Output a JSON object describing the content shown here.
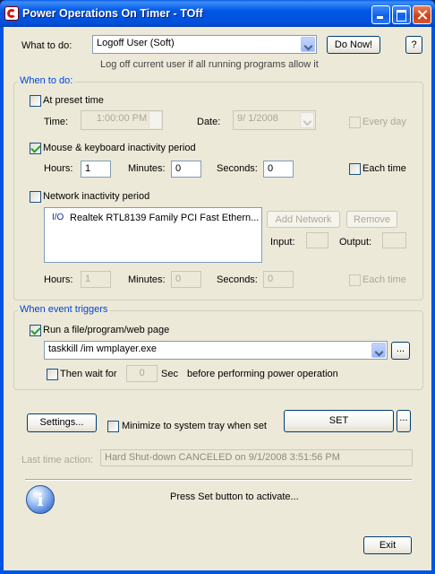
{
  "window": {
    "title": "Power Operations On Timer - TOff"
  },
  "what_to_do": {
    "label": "What to do:",
    "selected": "Logoff User (Soft)",
    "do_now_label": "Do Now!",
    "help_label": "?",
    "description": "Log off current user if all running programs allow it"
  },
  "when_to_do": {
    "title": "When to do:",
    "preset": {
      "label": "At preset time",
      "checked": false,
      "time_label": "Time:",
      "time_value": "1:00:00 PM",
      "date_label": "Date:",
      "date_value": "9/  1/2008",
      "every_day_label": "Every day"
    },
    "inactivity": {
      "label": "Mouse & keyboard inactivity period",
      "checked": true,
      "hours_label": "Hours:",
      "hours": "1",
      "minutes_label": "Minutes:",
      "minutes": "0",
      "seconds_label": "Seconds:",
      "seconds": "0",
      "each_time_label": "Each time"
    },
    "network": {
      "label": "Network inactivity period",
      "checked": false,
      "adapter_prefix": "I/O",
      "adapter": "Realtek RTL8139 Family PCI Fast Ethern...",
      "add_label": "Add Network",
      "remove_label": "Remove",
      "input_label": "Input:",
      "output_label": "Output:",
      "hours_label": "Hours:",
      "hours": "1",
      "minutes_label": "Minutes:",
      "minutes": "0",
      "seconds_label": "Seconds:",
      "seconds": "0",
      "each_time_label": "Each time"
    }
  },
  "event_triggers": {
    "title": "When event triggers",
    "run_label": "Run a file/program/web page",
    "run_checked": true,
    "command": "taskkill /im wmplayer.exe",
    "browse_label": "...",
    "wait_label": "Then wait for",
    "wait_value": "0",
    "sec_label": "Sec",
    "before_label": "before performing power operation"
  },
  "bottom": {
    "settings_label": "Settings...",
    "minimize_label": "Minimize to system tray when set",
    "set_label": "SET",
    "set_more_label": "...",
    "last_action_label": "Last time action:",
    "last_action_value": "Hard Shut-down CANCELED on 9/1/2008 3:51:56 PM",
    "status": "Press Set button to activate...",
    "exit_label": "Exit"
  }
}
